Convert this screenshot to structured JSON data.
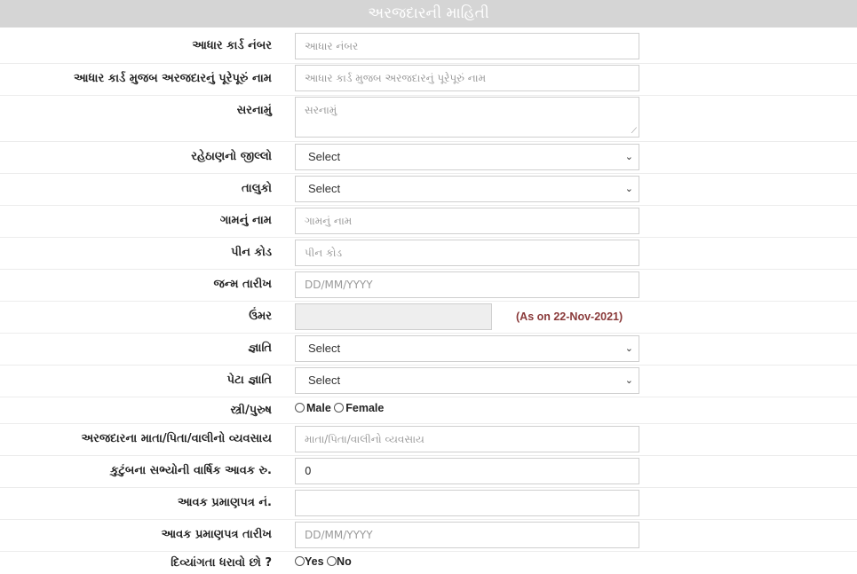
{
  "section_title": "અરજદારની માહિતી",
  "fields": {
    "aadhaar_no": {
      "label": "આધાર કાર્ડ નંબર",
      "placeholder": "આધાર નંબર"
    },
    "name": {
      "label": "આધાર કાર્ડ મુજબ અરજદારનું પૂરેપૂરું નામ",
      "placeholder": "આધાર કાર્ડ મુજબ અરજદારનું પૂરેપૂરું નામ"
    },
    "address": {
      "label": "સરનામું",
      "placeholder": "સરનામું"
    },
    "district": {
      "label": "રહેઠાણનો જીલ્લો",
      "value": "Select"
    },
    "taluka": {
      "label": "તાલુકો",
      "value": "Select"
    },
    "village": {
      "label": "ગામનું નામ",
      "placeholder": "ગામનું નામ"
    },
    "pincode": {
      "label": "પીન કોડ",
      "placeholder": "પીન કોડ"
    },
    "dob": {
      "label": "જન્મ તારીખ",
      "placeholder": "DD/MM/YYYY"
    },
    "age": {
      "label": "ઉંમર",
      "note": "(As on 22-Nov-2021)"
    },
    "caste": {
      "label": "જ્ઞાતિ",
      "value": "Select"
    },
    "subcaste": {
      "label": "પેટા જ્ઞાતિ",
      "value": "Select"
    },
    "gender": {
      "label": "સ્ત્રી/પુરુષ",
      "options": [
        "Male",
        "Female"
      ]
    },
    "occupation": {
      "label": "અરજદારના માતા/પિતા/વાલીનો વ્યવસાય",
      "placeholder": "માતા/પિતા/વાલીનો વ્યવસાય"
    },
    "income": {
      "label": "કુટુંબના સભ્યોની વાર્ષિક આવક રુ.",
      "value": "0"
    },
    "income_cert_no": {
      "label": "આવક પ્રમાણપત્ર નં.",
      "value": ""
    },
    "income_cert_date": {
      "label": "આવક પ્રમાણપત્ર તારીખ",
      "placeholder": "DD/MM/YYYY"
    },
    "disability": {
      "label": "દિવ્યાંગતા ધરાવો છો ?",
      "options": [
        "Yes",
        "No"
      ]
    }
  }
}
